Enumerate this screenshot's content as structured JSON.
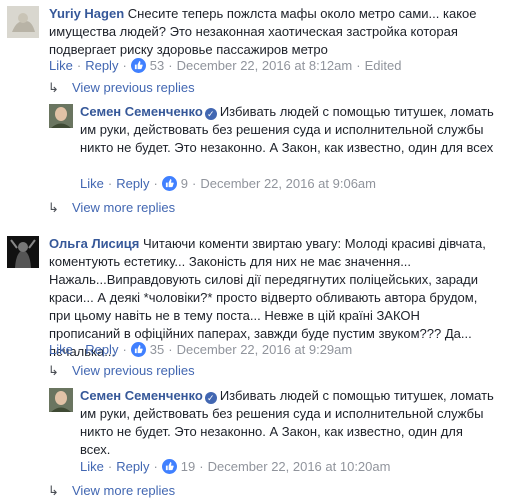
{
  "comments": [
    {
      "author": "Yuriy Hagen",
      "text": "Снесите теперь пожлста мафы около метро сами... какое имущества людей? Это незаконная хаотическая застройка которая подвергает риску здоровье пассажиров метро",
      "like_label": "Like",
      "reply_label": "Reply",
      "likes": "53",
      "date": "December 22, 2016 at 8:12am",
      "edited": "Edited",
      "view_previous": "View previous replies",
      "reply": {
        "author": "Семен Семенченко",
        "text": "Избивать людей с помощью титушек, ломать им руки, действовать без решения суда и исполнительной службы никто не будет. Это незаконно. А Закон, как известно, один для всех",
        "like_label": "Like",
        "reply_label": "Reply",
        "likes": "9",
        "date": "December 22, 2016 at 9:06am"
      },
      "view_more": "View more replies"
    },
    {
      "author": "Ольга Лисиця",
      "text": "Читаючи коменти звиртаю увагу: Молоді красиві дівчата, коментують естетику... Законість для них не має значення... Нажаль...Виправдовують силові дії передягнутих поліцейських, заради краси... А деякі *чоловіки?* просто відверто обливають автора брудом, при цьому навіть не в тему поста... Невже в цій країні ЗАКОН прописаний в офіційних паперах, завжди буде пустим звуком??? Да... пєчалька...",
      "like_label": "Like",
      "reply_label": "Reply",
      "likes": "35",
      "date": "December 22, 2016 at 9:29am",
      "view_previous": "View previous replies",
      "reply": {
        "author": "Семен Семенченко",
        "text": "Избивать людей с помощью титушек, ломать им руки, действовать без решения суда и исполнительной службы никто не будет. Это незаконно. А Закон, как известно, один для всех.",
        "like_label": "Like",
        "reply_label": "Reply",
        "likes": "19",
        "date": "December 22, 2016 at 10:20am"
      },
      "view_more": "View more replies"
    }
  ],
  "colors": {
    "link": "#365899",
    "action": "#4267b2",
    "meta": "#90949c",
    "like_badge": "#4080ff"
  }
}
